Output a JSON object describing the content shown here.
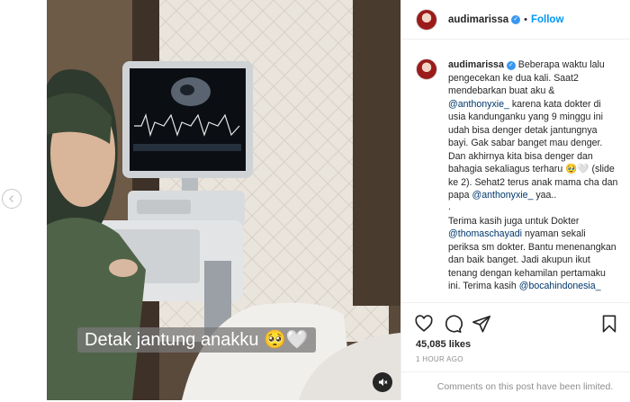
{
  "post": {
    "username": "audimarissa",
    "follow_label": "Follow",
    "dot": "•",
    "video_caption": "Detak jantung anakku 🥺🤍",
    "caption_author": "audimarissa",
    "caption_segments": [
      {
        "text": "Beberapa waktu lalu pengecekan ke dua kali. Saat2 mendebarkan buat aku & ",
        "type": "text"
      },
      {
        "text": "@anthonyxie_",
        "type": "mention"
      },
      {
        "text": " karena kata dokter di usia kandunganku yang 9 minggu ini udah bisa denger detak jantungnya bayi. Gak sabar banget mau denger. Dan akhirnya kita bisa denger dan bahagia sekaliagus terharu 🥹🤍 (slide ke 2). Sehat2 terus anak mama cha dan papa ",
        "type": "text"
      },
      {
        "text": "@anthonyxie_",
        "type": "mention"
      },
      {
        "text": " yaa..",
        "type": "text"
      }
    ],
    "separator": ".",
    "caption_segments_2": [
      {
        "text": "Terima kasih juga untuk Dokter ",
        "type": "text"
      },
      {
        "text": "@thomaschayadi",
        "type": "mention"
      },
      {
        "text": " nyaman sekali periksa sm dokter. Bantu menenangkan dan baik banget. Jadi akupun ikut tenang dengan kehamilan pertamaku ini. Terima kasih ",
        "type": "text"
      },
      {
        "text": "@bocahindonesia_",
        "type": "mention"
      }
    ],
    "likes": "45,085 likes",
    "time_ago": "1 HOUR AGO",
    "comments_notice": "Comments on this post have been limited.",
    "icons": [
      "heart-icon",
      "comment-icon",
      "share-icon",
      "bookmark-icon"
    ],
    "colors": {
      "link": "#0095f6",
      "mention": "#00376b",
      "muted": "#8e8e8e",
      "verified": "#3897f0"
    }
  }
}
